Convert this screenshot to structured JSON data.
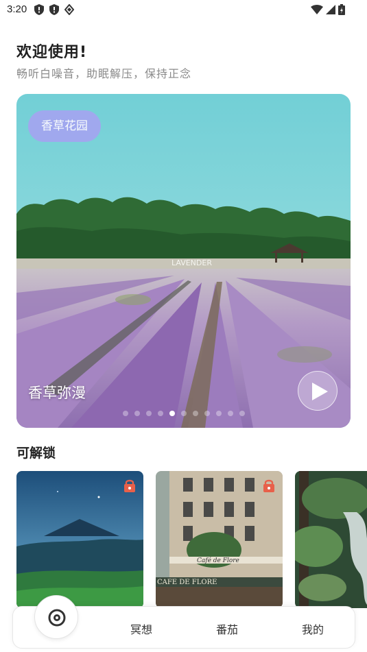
{
  "status_bar": {
    "time": "3:20"
  },
  "header": {
    "title": "欢迎使用!",
    "subtitle": "畅听白噪音，助眠解压，保持正念"
  },
  "hero": {
    "tag": "香草花园",
    "caption": "香草弥漫",
    "sign_text": "LAVENDER",
    "slide_count": 11,
    "active_slide": 5
  },
  "unlock": {
    "title": "可解锁",
    "cards": [
      {
        "name": "mountain-night",
        "locked": true
      },
      {
        "name": "cafe-de-flore",
        "locked": true,
        "sign_text": "Café de Flore",
        "awning_text": "CAFE DE FLORE"
      },
      {
        "name": "forest-stream",
        "locked": false
      }
    ]
  },
  "bottom_nav": {
    "items": [
      "冥想",
      "番茄",
      "我的"
    ]
  },
  "colors": {
    "tag_bg": "#a3a6f0",
    "lock": "#e8604a",
    "sky": "#7fd0d6",
    "lavender": "#a88bc4"
  }
}
